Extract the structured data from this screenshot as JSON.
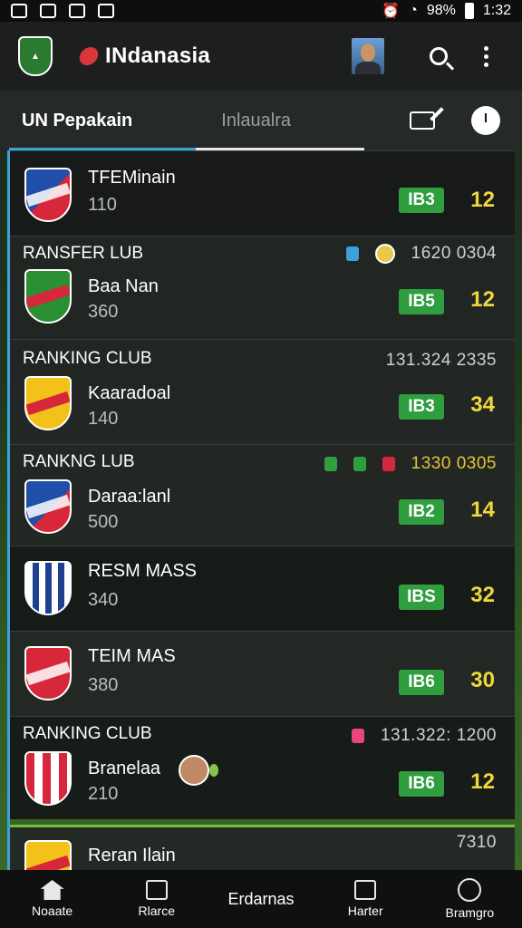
{
  "status_bar": {
    "battery_pct": "98%",
    "time": "1:32"
  },
  "app_bar": {
    "title": "INdanasia"
  },
  "tabs": [
    {
      "label": "UN Pepakain"
    },
    {
      "label": "Inlaualra"
    }
  ],
  "cards": [
    {
      "label": "",
      "team": "TFEMinain",
      "sub": "110",
      "badge": "IB3",
      "score": "12",
      "meta": ""
    },
    {
      "label": "RANSFER LUB",
      "team": "Baa Nan",
      "sub": "360",
      "badge": "IB5",
      "score": "12",
      "meta": "1620 0304"
    },
    {
      "label": "RANKING CLUB",
      "team": "Kaaradoal",
      "sub": "140",
      "badge": "IB3",
      "score": "34",
      "meta": "131.324 2335"
    },
    {
      "label": "RANKNG LUB",
      "team": "Daraa:lanl",
      "sub": "500",
      "badge": "IB2",
      "score": "14",
      "meta": "1330 0305"
    },
    {
      "label": "",
      "team": "RESM MASS",
      "sub": "340",
      "badge": "IBS",
      "score": "32",
      "meta": ""
    },
    {
      "label": "",
      "team": "TEIM MAS",
      "sub": "380",
      "badge": "IB6",
      "score": "30",
      "meta": ""
    },
    {
      "label": "RANKING CLUB",
      "team": "Branelaa",
      "sub": "210",
      "badge": "IB6",
      "score": "12",
      "meta": "131.322: 1200"
    },
    {
      "label": "",
      "team": "Reran Ilain",
      "sub": "",
      "badge": "",
      "score": "",
      "meta": "7310"
    }
  ],
  "bottom_nav": [
    {
      "label": "Noaate"
    },
    {
      "label": "Rlarce"
    },
    {
      "label": "Erdarnas"
    },
    {
      "label": "Harter"
    },
    {
      "label": "Bramgro"
    }
  ],
  "colors": {
    "accent_blue": "#3da1d8",
    "badge_green": "#2e9e3e",
    "score_yellow": "#f0d83a"
  }
}
